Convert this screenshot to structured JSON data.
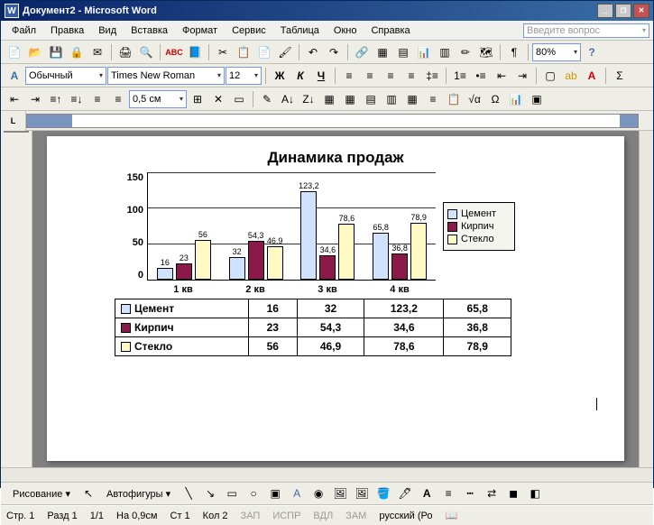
{
  "window": {
    "title": "Документ2 - Microsoft Word",
    "app_icon": "W"
  },
  "menu": [
    "Файл",
    "Правка",
    "Вид",
    "Вставка",
    "Формат",
    "Сервис",
    "Таблица",
    "Окно",
    "Справка"
  ],
  "help_placeholder": "Введите вопрос",
  "zoom": "80%",
  "toolbar2": {
    "style": "Обычный",
    "font": "Times New Roman",
    "size": "12",
    "bold": "Ж",
    "italic": "К",
    "underline": "Ч"
  },
  "toolbar3": {
    "indent": "0,5 см"
  },
  "draw": {
    "label": "Рисование",
    "autoshapes": "Автофигуры"
  },
  "status": {
    "page": "Стр. 1",
    "section": "Разд 1",
    "pages": "1/1",
    "at": "На 0,9см",
    "line": "Ст 1",
    "col": "Кол 2",
    "mode1": "ЗАП",
    "mode2": "ИСПР",
    "mode3": "ВДЛ",
    "mode4": "ЗАМ",
    "lang": "русский (Ро"
  },
  "chart_data": {
    "type": "bar",
    "title": "Динамика продаж",
    "categories": [
      "1 кв",
      "2 кв",
      "3 кв",
      "4 кв"
    ],
    "series": [
      {
        "name": "Цемент",
        "color": "#cfe2ff",
        "values": [
          16,
          32,
          123.2,
          65.8
        ]
      },
      {
        "name": "Кирпич",
        "color": "#8b1a4b",
        "values": [
          23,
          54.3,
          34.6,
          36.8
        ]
      },
      {
        "name": "Стекло",
        "color": "#fff9c4",
        "values": [
          56,
          46.9,
          78.6,
          78.9
        ]
      }
    ],
    "ylim": [
      0,
      150
    ],
    "yticks": [
      0,
      50,
      100,
      150
    ]
  },
  "table_labels": {
    "v": [
      "16",
      "32",
      "123,2",
      "65,8",
      "23",
      "54,3",
      "34,6",
      "36,8",
      "56",
      "46,9",
      "78,6",
      "78,9"
    ],
    "bar": [
      "16",
      "23",
      "56",
      "32",
      "54,3",
      "46,9",
      "123,2",
      "34,6",
      "78,6",
      "65,8",
      "36,8",
      "78,9"
    ]
  }
}
